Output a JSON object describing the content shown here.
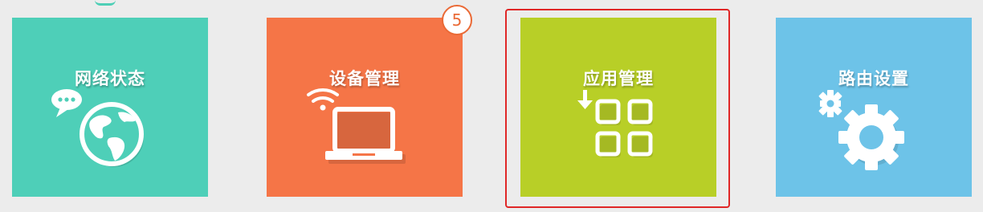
{
  "tiles": [
    {
      "id": "network",
      "label": "网络状态",
      "color": "#4ecfb8",
      "icon": "globe-with-chat-icon",
      "selected": false
    },
    {
      "id": "devices",
      "label": "设备管理",
      "color": "#f57547",
      "icon": "laptop-wifi-icon",
      "selected": false,
      "badge": "5"
    },
    {
      "id": "apps",
      "label": "应用管理",
      "color": "#b8cf27",
      "icon": "app-grid-download-icon",
      "selected": true
    },
    {
      "id": "router",
      "label": "路由设置",
      "color": "#6dc3e8",
      "icon": "gears-icon",
      "selected": false
    }
  ],
  "colors": {
    "badge_border": "#ea6a36",
    "selection_frame": "#e02727",
    "background": "#ececec"
  }
}
